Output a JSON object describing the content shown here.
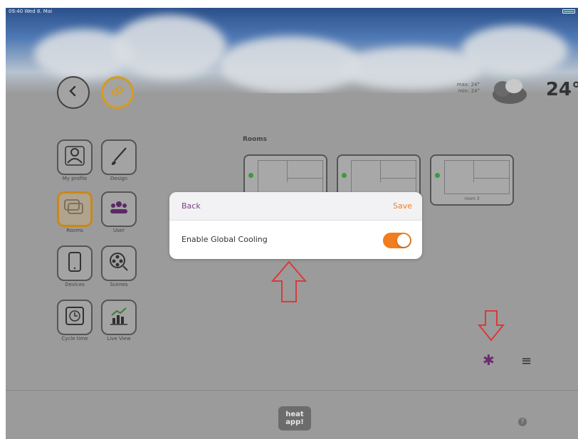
{
  "status_bar": {
    "time": "09:40 Wed 8. Mai"
  },
  "weather": {
    "max": "max: 24°",
    "min": "min: 24°",
    "temperature": "24°"
  },
  "nav": {
    "items": [
      {
        "id": "my-profile",
        "label": "My profile",
        "icon": "user-profile-icon",
        "active": false
      },
      {
        "id": "design",
        "label": "Design",
        "icon": "brush-icon",
        "active": false
      },
      {
        "id": "rooms",
        "label": "Rooms",
        "icon": "rooms-icon",
        "active": true
      },
      {
        "id": "user",
        "label": "User",
        "icon": "users-icon",
        "active": false
      },
      {
        "id": "devices",
        "label": "Devices",
        "icon": "tablet-icon",
        "active": false
      },
      {
        "id": "scenes",
        "label": "Scenes",
        "icon": "film-reel-icon",
        "active": false
      },
      {
        "id": "cycle-time",
        "label": "Cycle time",
        "icon": "clock-icon",
        "active": false
      },
      {
        "id": "live-view",
        "label": "Live View",
        "icon": "live-chart-icon",
        "active": false
      }
    ]
  },
  "rooms": {
    "title": "Rooms",
    "items": [
      {
        "name": ""
      },
      {
        "name": ""
      },
      {
        "name": "room 3"
      }
    ]
  },
  "modal": {
    "back_label": "Back",
    "save_label": "Save",
    "setting_label": "Enable Global Cooling",
    "toggle_on": true
  },
  "footer": {
    "logo_text": "heat app!"
  },
  "colors": {
    "accent": "#f07d1e",
    "purple": "#7a3e84",
    "gold": "#d79b1c",
    "arrow_red": "#d93a3a"
  }
}
